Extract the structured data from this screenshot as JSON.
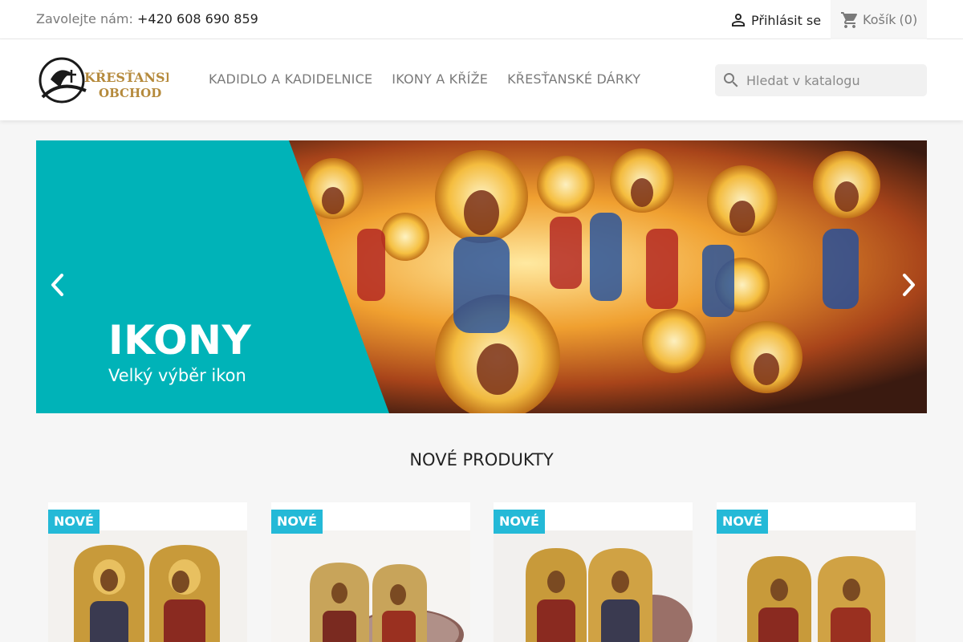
{
  "topbar": {
    "contact_label": "Zavolejte nám:",
    "phone": "+420 608 690 859",
    "signin_label": "Přihlásit se",
    "cart_label": "Košík",
    "cart_count": "(0)"
  },
  "header": {
    "logo_line1": "KŘESŤANSKÝ",
    "logo_line2": "OBCHOD",
    "nav": [
      "KADIDLO A KADIDELNICE",
      "IKONY A KŘÍŽE",
      "KŘESŤANSKÉ DÁRKY"
    ],
    "search_placeholder": "Hledat v katalogu"
  },
  "banner": {
    "title": "IKONY",
    "subtitle": "Velký výběr ikon"
  },
  "new_products": {
    "title": "NOVÉ PRODUKTY",
    "badge": "NOVÉ",
    "items": [
      {
        "badge": "NOVÉ"
      },
      {
        "badge": "NOVÉ"
      },
      {
        "badge": "NOVÉ"
      },
      {
        "badge": "NOVÉ"
      }
    ]
  },
  "colors": {
    "accent": "#24b9d7",
    "banner_teal": "#00b3b8",
    "text_dark": "#232323",
    "text_muted": "#7a7a7a"
  },
  "icons": [
    "person-icon",
    "cart-icon",
    "search-icon",
    "chevron-left-icon",
    "chevron-right-icon"
  ]
}
